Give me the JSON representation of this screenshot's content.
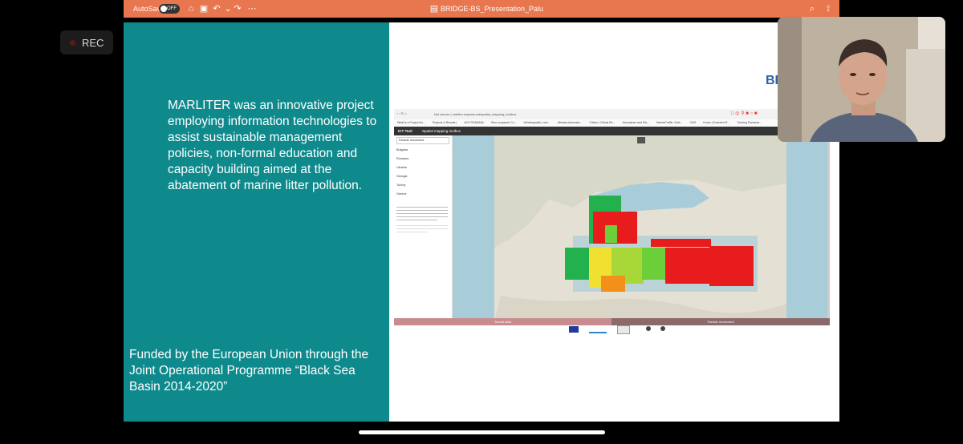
{
  "window": {
    "autosave_label": "AutoSave",
    "autosave_state": "OFF",
    "title": "BRIDGE-BS_Presentation_Palu"
  },
  "recording": {
    "label": "REC"
  },
  "slide": {
    "main_text": "MARLITER was an innovative project employing information technologies to assist sustainable management policies, non-formal education and capacity building aimed at the abatement of marine litter pollution.",
    "funding_text": "Funded by the European Union through the Joint Operational Programme “Black Sea Basin 2014-2020”",
    "logo_text": "BRI"
  },
  "embedded_browser": {
    "url": "Not secure | marliter.maparound/spatial_mapping_toolbox",
    "bookmarks": [
      "What is a Project Nu...",
      "Projects & Results |",
      "ACS ROMANIA",
      "Dinu-coopwork Co...",
      "Windowpublic | min...",
      "Albania Automatic...",
      "Citizen | Global Re...",
      "Abundance and Dis...",
      "MarineTraffic: Glob...",
      "CMS",
      "Home | Entrebert R...",
      "Tutoring Romania..."
    ],
    "app_name": "ICT Tool",
    "app_subtitle": "Spatial mapping toolbox",
    "sidebar_header": "Particle movement",
    "sidebar_items": [
      "Bulgaria",
      "Romania",
      "Ukraine",
      "Georgia",
      "Turkey",
      "Greece"
    ],
    "left_tab": "Tourist data",
    "right_tab": "Particle movement"
  },
  "colors": {
    "titlebar": "#e8764e",
    "slide_teal": "#0f8a8c",
    "logo_blue": "#2f5f9e",
    "left_tab_bg": "#c98c8e",
    "right_tab_bg": "#8c6a6b"
  }
}
